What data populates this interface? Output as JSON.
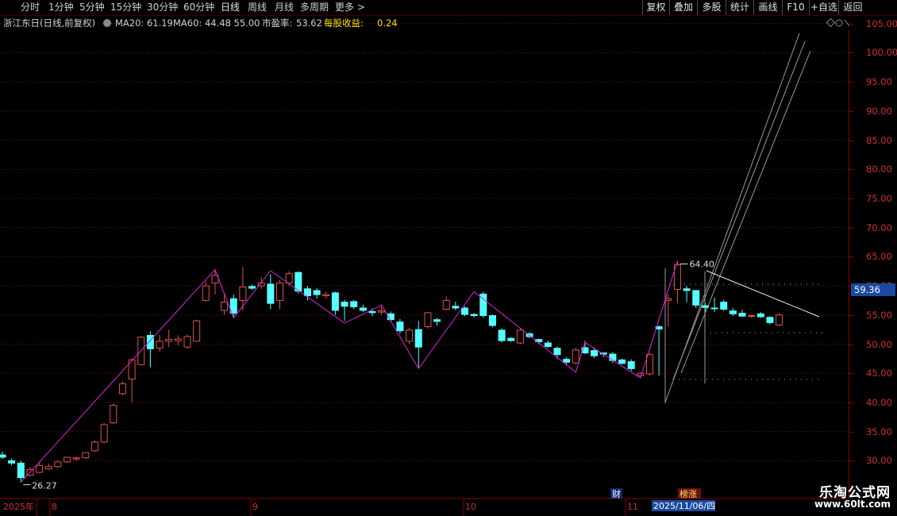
{
  "toolbar": {
    "left_tabs": [
      "分时",
      "1分钟",
      "5分钟",
      "15分钟",
      "30分钟",
      "60分钟",
      "日线",
      "周线",
      "月线",
      "多周期",
      "更多 >"
    ],
    "active_tab": "日线",
    "right_buttons": [
      "复权",
      "叠加",
      "多股",
      "统计",
      "画线",
      "F10",
      "+自选",
      "返回"
    ]
  },
  "info": {
    "stock": "浙江东日(日线,前复权)",
    "ma20": "MA20: 61.19",
    "ma60": "MA60: 44.48",
    "price": ": 55.00",
    "pe_label": "市盈率:",
    "pe_value": "53.62",
    "eps_label": "每股收益:",
    "eps_value": "0.24",
    "icons": [
      "diamond-icon",
      "circle-icon",
      "close-icon"
    ]
  },
  "axis": {
    "ticks": [
      "105.00",
      "100.00",
      "95.00",
      "90.00",
      "85.00",
      "80.00",
      "75.00",
      "70.00",
      "65.00",
      "60.00",
      "55.00",
      "50.00",
      "45.00",
      "40.00",
      "35.00",
      "30.00"
    ],
    "current_price": "59.36"
  },
  "date_axis": {
    "year": "2025年",
    "months": [
      "8",
      "9",
      "10",
      "11"
    ],
    "cursor_date": "2025/11/06/四",
    "markers": [
      "财",
      "榜涨"
    ]
  },
  "annotations": {
    "low_label": "26.27",
    "high_label": "64.40"
  },
  "watermark": {
    "title": "乐淘公式网",
    "url": "www.60lt.com"
  },
  "colors": {
    "up": "#e05050",
    "down": "#54ffff",
    "zigzag": "#e020e0",
    "grid": "#7a1010",
    "axis_text": "#d03030",
    "highlight_blue": "#1a4aa0",
    "eps_text": "#ffe000"
  },
  "chart_data": {
    "type": "candlestick",
    "ylim": [
      27.0,
      107.0
    ],
    "x_months": [
      "8",
      "9",
      "10",
      "11"
    ],
    "candles": [
      {
        "o": 31.0,
        "h": 31.6,
        "l": 30.3,
        "c": 30.6
      },
      {
        "o": 30.0,
        "h": 30.4,
        "l": 29.2,
        "c": 29.6
      },
      {
        "o": 29.6,
        "h": 30.0,
        "l": 26.3,
        "c": 27.1
      },
      {
        "o": 27.5,
        "h": 28.9,
        "l": 27.3,
        "c": 28.5
      },
      {
        "o": 28.0,
        "h": 29.6,
        "l": 27.9,
        "c": 29.2
      },
      {
        "o": 28.6,
        "h": 29.5,
        "l": 28.4,
        "c": 29.0
      },
      {
        "o": 29.0,
        "h": 30.0,
        "l": 28.8,
        "c": 29.8
      },
      {
        "o": 29.8,
        "h": 30.7,
        "l": 29.6,
        "c": 30.6
      },
      {
        "o": 30.3,
        "h": 30.7,
        "l": 30.0,
        "c": 30.5
      },
      {
        "o": 30.5,
        "h": 31.5,
        "l": 30.3,
        "c": 31.4
      },
      {
        "o": 31.7,
        "h": 33.5,
        "l": 31.5,
        "c": 33.2
      },
      {
        "o": 33.2,
        "h": 36.5,
        "l": 33.0,
        "c": 36.2
      },
      {
        "o": 36.5,
        "h": 39.8,
        "l": 36.3,
        "c": 39.5
      },
      {
        "o": 41.5,
        "h": 43.6,
        "l": 41.2,
        "c": 43.2
      },
      {
        "o": 44.0,
        "h": 47.5,
        "l": 40.0,
        "c": 47.3
      },
      {
        "o": 46.5,
        "h": 51.3,
        "l": 46.3,
        "c": 51.2
      },
      {
        "o": 51.5,
        "h": 52.2,
        "l": 46.0,
        "c": 49.2
      },
      {
        "o": 49.3,
        "h": 51.6,
        "l": 48.7,
        "c": 50.5
      },
      {
        "o": 50.5,
        "h": 52.5,
        "l": 49.5,
        "c": 50.8
      },
      {
        "o": 50.6,
        "h": 51.5,
        "l": 49.8,
        "c": 50.9
      },
      {
        "o": 49.5,
        "h": 51.7,
        "l": 49.2,
        "c": 51.3
      },
      {
        "o": 50.5,
        "h": 54.2,
        "l": 50.4,
        "c": 54.0
      },
      {
        "o": 57.5,
        "h": 60.8,
        "l": 57.3,
        "c": 60.0
      },
      {
        "o": 60.5,
        "h": 62.8,
        "l": 58.5,
        "c": 61.8
      },
      {
        "o": 55.8,
        "h": 58.6,
        "l": 55.0,
        "c": 57.2
      },
      {
        "o": 57.8,
        "h": 58.5,
        "l": 54.5,
        "c": 55.3
      },
      {
        "o": 57.5,
        "h": 63.2,
        "l": 55.8,
        "c": 59.8
      },
      {
        "o": 59.9,
        "h": 60.2,
        "l": 59.3,
        "c": 59.6
      },
      {
        "o": 60.0,
        "h": 61.5,
        "l": 59.5,
        "c": 60.5
      },
      {
        "o": 60.3,
        "h": 62.0,
        "l": 56.0,
        "c": 57.0
      },
      {
        "o": 57.5,
        "h": 61.0,
        "l": 56.0,
        "c": 60.5
      },
      {
        "o": 60.5,
        "h": 62.5,
        "l": 60.0,
        "c": 62.1
      },
      {
        "o": 62.3,
        "h": 62.5,
        "l": 58.7,
        "c": 59.1
      },
      {
        "o": 59.5,
        "h": 60.0,
        "l": 57.5,
        "c": 58.3
      },
      {
        "o": 59.2,
        "h": 59.6,
        "l": 57.8,
        "c": 58.5
      },
      {
        "o": 58.3,
        "h": 59.0,
        "l": 57.8,
        "c": 58.5
      },
      {
        "o": 58.8,
        "h": 59.0,
        "l": 55.0,
        "c": 55.8
      },
      {
        "o": 57.2,
        "h": 57.6,
        "l": 54.0,
        "c": 56.5
      },
      {
        "o": 57.3,
        "h": 57.6,
        "l": 56.0,
        "c": 56.4
      },
      {
        "o": 56.2,
        "h": 56.8,
        "l": 55.5,
        "c": 55.8
      },
      {
        "o": 55.6,
        "h": 56.1,
        "l": 54.8,
        "c": 55.4
      },
      {
        "o": 55.5,
        "h": 56.5,
        "l": 55.0,
        "c": 55.7
      },
      {
        "o": 55.2,
        "h": 55.6,
        "l": 53.8,
        "c": 54.2
      },
      {
        "o": 53.8,
        "h": 54.3,
        "l": 51.8,
        "c": 52.3
      },
      {
        "o": 50.5,
        "h": 52.8,
        "l": 50.0,
        "c": 52.4
      },
      {
        "o": 52.5,
        "h": 54.0,
        "l": 46.0,
        "c": 49.5
      },
      {
        "o": 53.0,
        "h": 55.5,
        "l": 52.6,
        "c": 55.4
      },
      {
        "o": 54.2,
        "h": 54.5,
        "l": 53.2,
        "c": 53.9
      },
      {
        "o": 56.0,
        "h": 58.2,
        "l": 55.8,
        "c": 57.5
      },
      {
        "o": 56.5,
        "h": 57.3,
        "l": 55.8,
        "c": 56.2
      },
      {
        "o": 56.2,
        "h": 56.5,
        "l": 54.8,
        "c": 55.1
      },
      {
        "o": 55.1,
        "h": 55.3,
        "l": 54.6,
        "c": 54.9
      },
      {
        "o": 58.6,
        "h": 59.0,
        "l": 54.5,
        "c": 54.9
      },
      {
        "o": 54.9,
        "h": 55.1,
        "l": 52.9,
        "c": 53.2
      },
      {
        "o": 52.4,
        "h": 52.7,
        "l": 50.3,
        "c": 50.6
      },
      {
        "o": 51.0,
        "h": 51.2,
        "l": 50.4,
        "c": 50.6
      },
      {
        "o": 50.2,
        "h": 52.7,
        "l": 50.0,
        "c": 52.4
      },
      {
        "o": 51.8,
        "h": 52.0,
        "l": 51.0,
        "c": 51.3
      },
      {
        "o": 50.8,
        "h": 50.9,
        "l": 50.0,
        "c": 50.4
      },
      {
        "o": 50.2,
        "h": 50.6,
        "l": 49.3,
        "c": 49.6
      },
      {
        "o": 49.3,
        "h": 49.6,
        "l": 47.5,
        "c": 48.2
      },
      {
        "o": 47.4,
        "h": 47.8,
        "l": 46.5,
        "c": 46.9
      },
      {
        "o": 46.8,
        "h": 49.4,
        "l": 46.5,
        "c": 49.0
      },
      {
        "o": 49.4,
        "h": 50.6,
        "l": 48.3,
        "c": 48.5
      },
      {
        "o": 48.9,
        "h": 49.3,
        "l": 47.6,
        "c": 48.0
      },
      {
        "o": 48.5,
        "h": 48.6,
        "l": 47.8,
        "c": 48.3
      },
      {
        "o": 48.3,
        "h": 48.6,
        "l": 46.8,
        "c": 47.2
      },
      {
        "o": 47.3,
        "h": 47.5,
        "l": 46.5,
        "c": 46.7
      },
      {
        "o": 47.0,
        "h": 47.4,
        "l": 45.4,
        "c": 45.8
      },
      {
        "o": 44.6,
        "h": 45.2,
        "l": 44.2,
        "c": 45.0
      },
      {
        "o": 44.9,
        "h": 48.5,
        "l": 44.6,
        "c": 48.2
      },
      {
        "o": 53.0,
        "h": 53.2,
        "l": 44.6,
        "c": 52.6
      },
      {
        "o": 57.5,
        "h": 58.5,
        "l": 53.0,
        "c": 57.8
      },
      {
        "o": 59.4,
        "h": 64.3,
        "l": 57.0,
        "c": 63.6
      },
      {
        "o": 59.5,
        "h": 60.0,
        "l": 57.2,
        "c": 59.2
      },
      {
        "o": 59.2,
        "h": 59.3,
        "l": 56.2,
        "c": 56.7
      },
      {
        "o": 56.6,
        "h": 57.0,
        "l": 55.6,
        "c": 56.3
      },
      {
        "o": 56.2,
        "h": 58.0,
        "l": 55.5,
        "c": 56.1
      },
      {
        "o": 57.2,
        "h": 57.6,
        "l": 55.7,
        "c": 56.0
      },
      {
        "o": 55.7,
        "h": 56.2,
        "l": 54.8,
        "c": 55.2
      },
      {
        "o": 55.3,
        "h": 55.9,
        "l": 54.8,
        "c": 54.8
      },
      {
        "o": 54.8,
        "h": 55.0,
        "l": 54.5,
        "c": 54.9
      },
      {
        "o": 55.2,
        "h": 55.5,
        "l": 54.5,
        "c": 54.7
      },
      {
        "o": 54.6,
        "h": 54.8,
        "l": 53.4,
        "c": 53.7
      },
      {
        "o": 53.3,
        "h": 55.3,
        "l": 53.1,
        "c": 55.0
      }
    ],
    "zigzag": [
      {
        "index": 2,
        "price": 26.3
      },
      {
        "index": 23,
        "price": 62.8
      },
      {
        "index": 25,
        "price": 54.5
      },
      {
        "index": 29,
        "price": 62.6
      },
      {
        "index": 37,
        "price": 53.6
      },
      {
        "index": 41,
        "price": 56.7
      },
      {
        "index": 45,
        "price": 45.8
      },
      {
        "index": 51,
        "price": 59.0
      },
      {
        "index": 62,
        "price": 45.2
      },
      {
        "index": 63,
        "price": 50.3
      },
      {
        "index": 69,
        "price": 44.2
      },
      {
        "index": 73,
        "price": 64.3
      }
    ]
  }
}
